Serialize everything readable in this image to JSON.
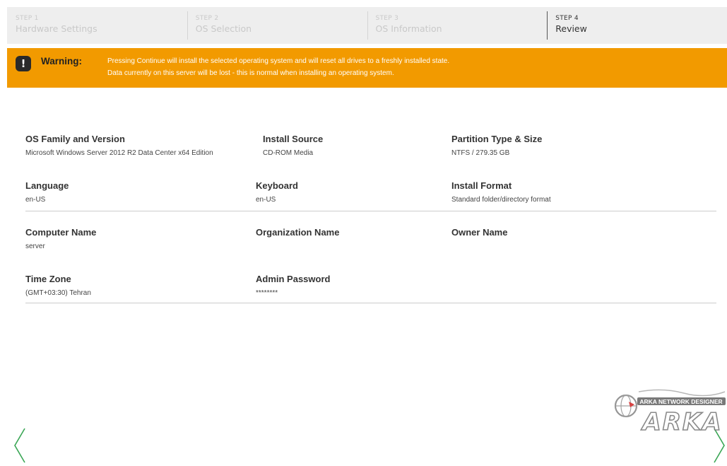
{
  "steps": [
    {
      "number": "STEP 1",
      "name": "Hardware Settings"
    },
    {
      "number": "STEP 2",
      "name": "OS Selection"
    },
    {
      "number": "STEP 3",
      "name": "OS Information"
    },
    {
      "number": "STEP 4",
      "name": "Review"
    }
  ],
  "warning": {
    "icon": "exclamation-icon",
    "icon_glyph": "!",
    "title": "Warning:",
    "line1": "Pressing Continue will install the selected operating system and will reset all drives to a freshly installed state.",
    "line2": "Data currently on this server will be lost - this is normal when installing an operating system."
  },
  "review": {
    "os_family": {
      "label": "OS Family and Version",
      "value": "Microsoft Windows Server 2012 R2 Data Center x64 Edition"
    },
    "install_source": {
      "label": "Install Source",
      "value": "CD-ROM Media"
    },
    "partition": {
      "label": "Partition Type & Size",
      "value": "NTFS / 279.35 GB"
    },
    "language": {
      "label": "Language",
      "value": "en-US"
    },
    "keyboard": {
      "label": "Keyboard",
      "value": "en-US"
    },
    "install_format": {
      "label": "Install Format",
      "value": "Standard folder/directory format"
    },
    "computer_name": {
      "label": "Computer Name",
      "value": "server"
    },
    "organization_name": {
      "label": "Organization Name",
      "value": ""
    },
    "owner_name": {
      "label": "Owner Name",
      "value": ""
    },
    "time_zone": {
      "label": "Time Zone",
      "value": "(GMT+03:30) Tehran"
    },
    "admin_password": {
      "label": "Admin Password",
      "value": "********"
    }
  },
  "navigation": {
    "previous_icon": "chevron-left-icon",
    "next_icon": "chevron-right-icon"
  },
  "watermark": {
    "text": "ARKA NETWORK DESIGNER",
    "logo": "ARKA"
  },
  "colors": {
    "banner": "#f29a00",
    "arrows": "#3aa655",
    "step_bar": "#eeeeee"
  }
}
